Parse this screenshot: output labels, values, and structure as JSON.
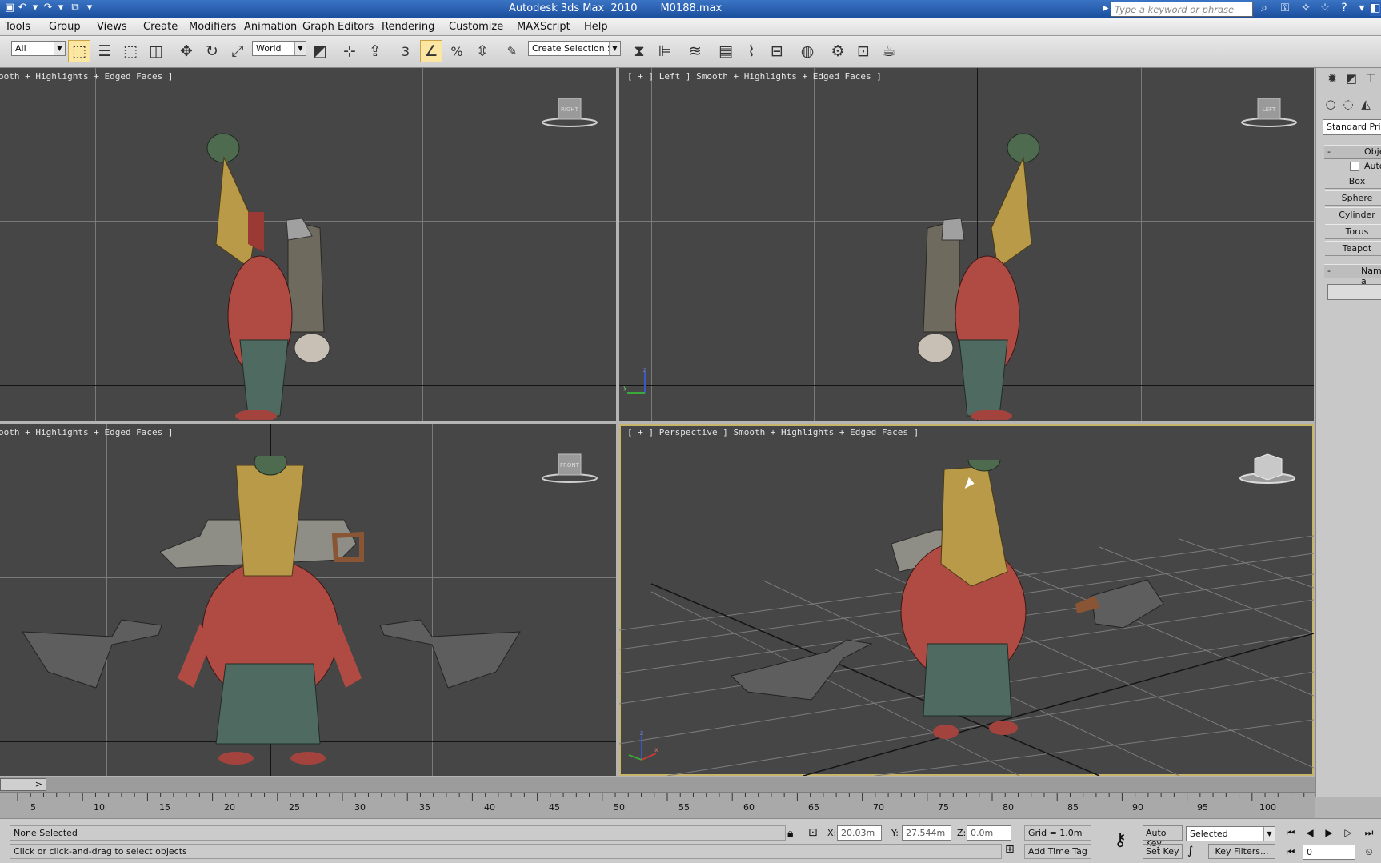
{
  "window": {
    "title": "Autodesk 3ds Max  2010       M0188.max",
    "search_placeholder": "Type a keyword or phrase"
  },
  "menu": [
    "Tools",
    "Group",
    "Views",
    "Create",
    "Modifiers",
    "Animation",
    "Graph Editors",
    "Rendering",
    "Customize",
    "MAXScript",
    "Help"
  ],
  "toolbar": {
    "selection_filter": "All",
    "reference_coord": "World",
    "named_selection": "Create Selection Se",
    "snap_label": "3",
    "angle_snap_label": "%"
  },
  "viewports": {
    "top_left_label": "ooth + Highlights + Edged Faces ]",
    "top_right_label": "[ + ] Left ] Smooth + Highlights + Edged Faces ]",
    "bottom_left_label": "ooth + Highlights + Edged Faces ]",
    "bottom_right_label": "[ + ] Perspective ] Smooth + Highlights + Edged Faces ]",
    "cube_right": "RIGHT",
    "cube_left": "LEFT",
    "cube_front": "FRONT",
    "axis_z": "z",
    "axis_y": "y",
    "axis_x": "x"
  },
  "command_panel": {
    "category": "Standard Primi",
    "rollout_object_type": "Obje",
    "autogrid": "Auto",
    "buttons": [
      "Box",
      "Sphere",
      "Cylinder",
      "Torus",
      "Teapot"
    ],
    "rollout_name": "Name a",
    "minus": "-"
  },
  "timeline": {
    "slider_arrow": ">",
    "ticks": [
      "5",
      "10",
      "15",
      "20",
      "25",
      "30",
      "35",
      "40",
      "45",
      "50",
      "55",
      "60",
      "65",
      "70",
      "75",
      "80",
      "85",
      "90",
      "95",
      "100"
    ]
  },
  "status": {
    "selection": "None Selected",
    "prompt": "Click or click-and-drag to select objects",
    "x_label": "X:",
    "x_value": "20.03m",
    "y_label": "Y:",
    "y_value": "27.544m",
    "z_label": "Z:",
    "z_value": "0.0m",
    "grid": "Grid = 1.0m",
    "add_time_tag": "Add Time Tag",
    "auto_key": "Auto Key",
    "set_key": "Set Key",
    "key_mode": "Selected",
    "key_filters": "Key Filters...",
    "frame": "0"
  }
}
